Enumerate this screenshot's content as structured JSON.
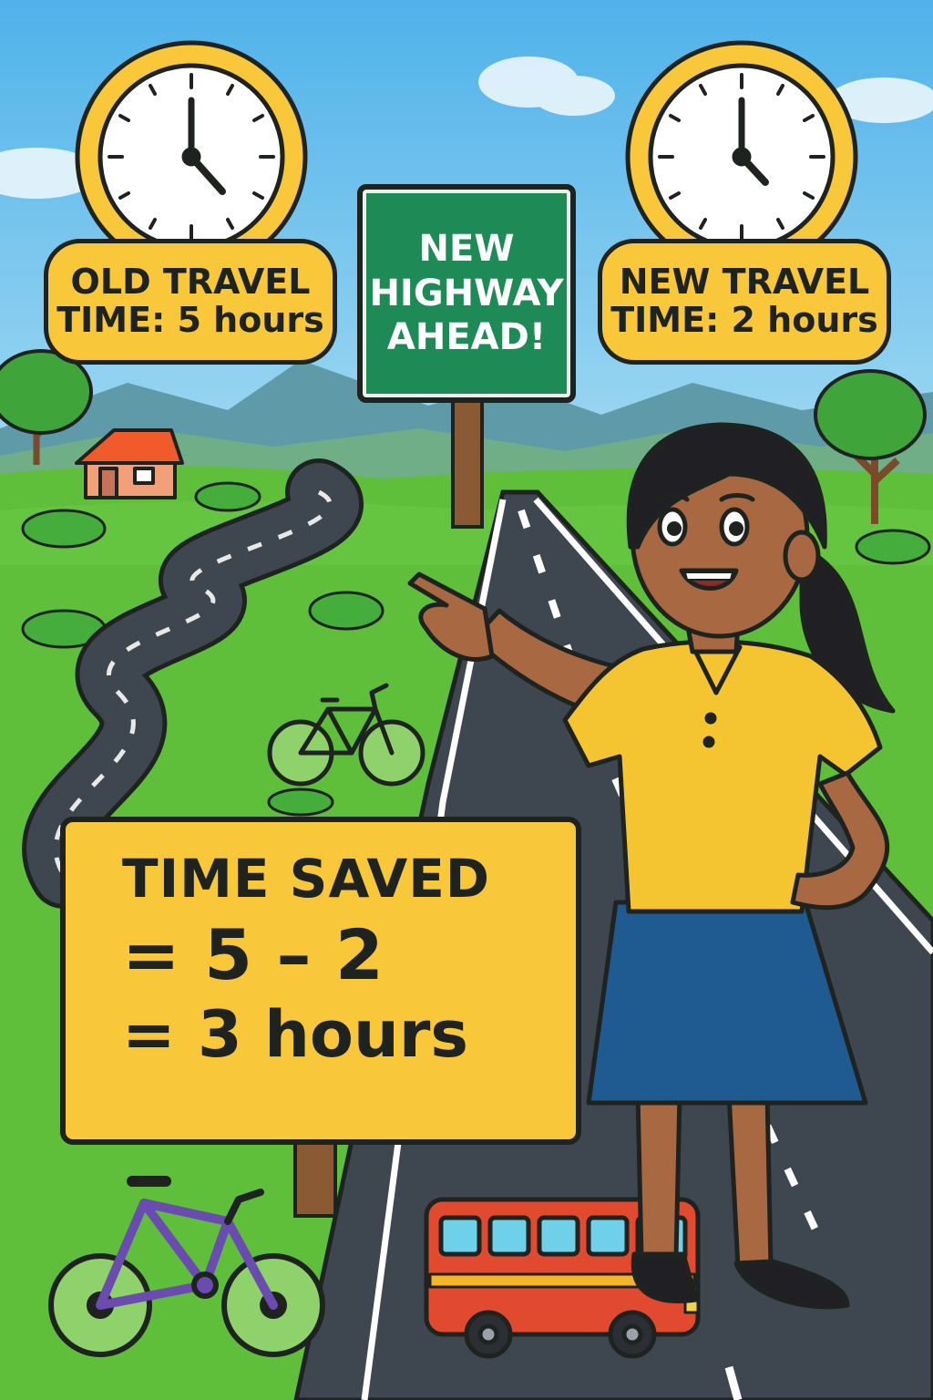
{
  "old_travel": {
    "line1": "OLD TRAVEL",
    "line2": "TIME: 5 hours"
  },
  "new_travel": {
    "line1": "NEW TRAVEL",
    "line2": "TIME: 2 hours"
  },
  "highway_sign": {
    "line1": "NEW",
    "line2": "HIGHWAY",
    "line3": "AHEAD!"
  },
  "calculation": {
    "title": "TIME SAVED",
    "line1": "= 5 – 2",
    "line2": "= 3 hours"
  },
  "colors": {
    "sky": "#6cc0ec",
    "grass": "#5fbf3b",
    "road": "#3e4650",
    "sign_yellow": "#f8c73a",
    "sign_green": "#1e8a55",
    "shirt": "#f5c431",
    "skirt": "#1f5a91",
    "bus": "#e14a2e"
  },
  "icons": [
    "clock-icon",
    "bicycle-icon",
    "bus-icon",
    "tree-icon",
    "house-icon"
  ]
}
